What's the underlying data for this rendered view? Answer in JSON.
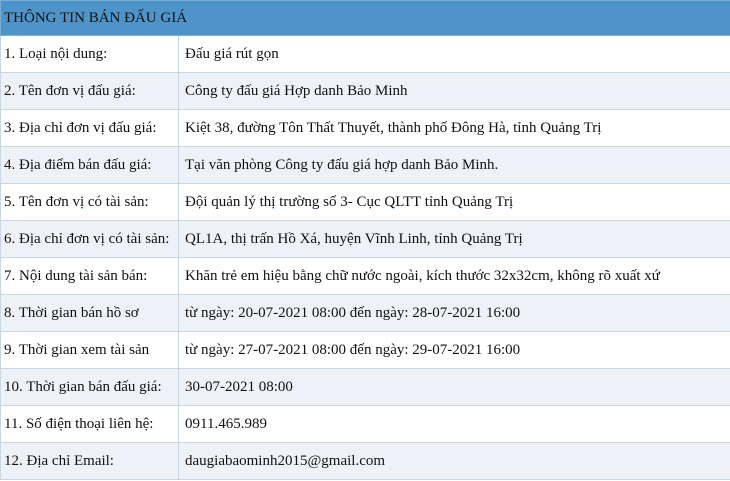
{
  "title": "THÔNG TIN BÁN ĐẤU GIÁ",
  "rows": [
    {
      "label": "1. Loại nội dung:",
      "value": "Đấu giá rút gọn"
    },
    {
      "label": "2. Tên đơn vị đấu giá:",
      "value": "Công ty đấu giá Hợp danh Bảo Minh"
    },
    {
      "label": "3. Địa chỉ đơn vị đấu giá:",
      "value": "Kiệt 38, đường Tôn Thất Thuyết, thành phố Đông Hà, tỉnh Quảng Trị"
    },
    {
      "label": "4. Địa điểm bán đấu giá:",
      "value": "Tại văn phòng Công ty đấu giá hợp danh Bảo Minh."
    },
    {
      "label": "5. Tên đơn vị có tài sản:",
      "value": "Đội quản lý thị trường số 3- Cục QLTT tỉnh Quảng Trị"
    },
    {
      "label": "6. Địa chỉ đơn vị có tài sản:",
      "value": "QL1A, thị trấn Hồ Xá, huyện Vĩnh Linh, tỉnh Quảng Trị"
    },
    {
      "label": "7. Nội dung tài sản bán:",
      "value": "Khăn trẻ em hiệu bằng chữ nước ngoài, kích thước 32x32cm, không rõ xuất xứ"
    },
    {
      "label": "8. Thời gian bán hồ sơ",
      "value": "từ ngày: 20-07-2021 08:00 đến ngày: 28-07-2021 16:00"
    },
    {
      "label": "9. Thời gian xem tài sản",
      "value": "từ ngày: 27-07-2021 08:00 đến ngày: 29-07-2021 16:00"
    },
    {
      "label": "10. Thời gian bán đấu giá:",
      "value": "30-07-2021 08:00"
    },
    {
      "label": "11. Số điện thoại liên hệ:",
      "value": "0911.465.989"
    },
    {
      "label": "12. Địa chỉ Email:",
      "value": "daugiabaominh2015@gmail.com"
    }
  ]
}
